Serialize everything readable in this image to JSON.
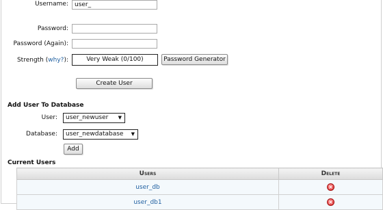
{
  "form": {
    "username_label": "Username:",
    "username_value": "user_",
    "password_label": "Password:",
    "password_again_label": "Password (Again):",
    "strength_label": "Strength",
    "strength_open": "(",
    "strength_link": "why?",
    "strength_close": "):",
    "strength_value": "Very Weak (0/100)",
    "generator_button": "Password Generator",
    "create_button": "Create User"
  },
  "add_to_db": {
    "title": "Add User To Database",
    "user_label": "User:",
    "user_selected": "user_newuser",
    "database_label": "Database:",
    "database_selected": "user_newdatabase",
    "add_button": "Add"
  },
  "current_users": {
    "title": "Current Users",
    "columns": [
      "Users",
      "Delete"
    ],
    "rows": [
      {
        "name": "user_db",
        "delete_icon": "delete-icon"
      },
      {
        "name": "user_db1",
        "delete_icon": "delete-icon"
      }
    ]
  },
  "colors": {
    "link": "#1f5fa0",
    "delete": "#d72020",
    "row_bg": "#f4f9fc"
  }
}
